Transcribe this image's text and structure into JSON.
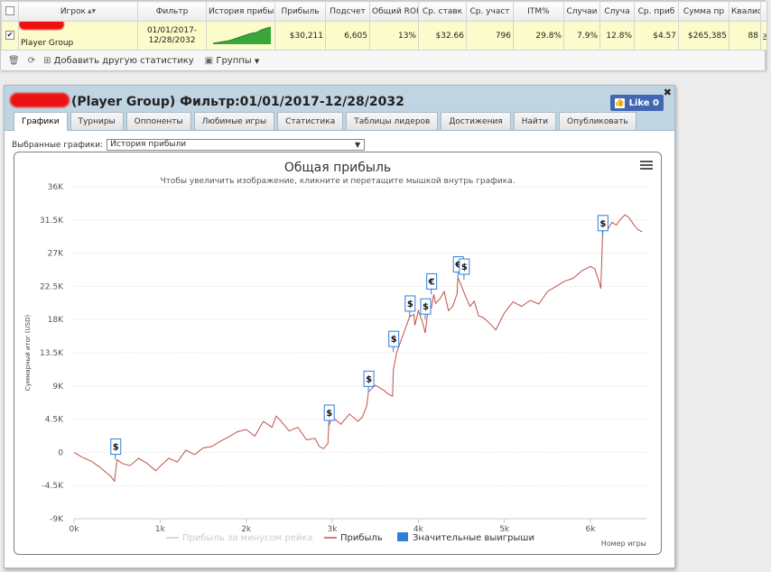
{
  "stats_table": {
    "headers": [
      "Игрок",
      "Фильтр",
      "История прибы",
      "Прибыль",
      "Подсчет",
      "Общий ROI",
      "Ср. ставк",
      "Ср. участ",
      "ITM%",
      "Случаи",
      "Случа",
      "Ср. приб",
      "Сумма пр",
      "Квалис"
    ],
    "row": {
      "player": "Player Group",
      "filter": "01/01/2017-12/28/2032",
      "profit": "$30,211",
      "count": "6,605",
      "roi": "13%",
      "avg_stake": "$32.66",
      "avg_entrants": "796",
      "itm": "29.8%",
      "cases1": "7.9%",
      "cases2": "12.8%",
      "avg_profit": "$4.57",
      "sum_profit": "$265,385",
      "qual": "88",
      "x": "x"
    },
    "toolbar": {
      "add_stat": "Добавить другую статистику",
      "groups": "Группы"
    }
  },
  "window": {
    "title": "(Player Group) Фильтр:01/01/2017-12/28/2032",
    "like_label": "Like 0",
    "tabs": [
      "Графики",
      "Турниры",
      "Оппоненты",
      "Любимые игры",
      "Статистика",
      "Таблицы лидеров",
      "Достижения",
      "Найти",
      "Опубликовать"
    ],
    "active_tab": "Графики",
    "selected_charts_label": "Выбранные графики:",
    "selected_chart": "История прибыли"
  },
  "chart_data": {
    "type": "line",
    "title": "Общая прибыль",
    "subtitle": "Чтобы увеличить изображение, кликните и перетащите мышкой внутрь графика.",
    "ylabel": "Суммарный итог (USD)",
    "xlabel": "Номер игры",
    "ylim": [
      -9000,
      36000
    ],
    "xlim": [
      0,
      6650
    ],
    "yticks": [
      -9000,
      -4500,
      0,
      4500,
      9000,
      13500,
      18000,
      22500,
      27000,
      31500,
      36000
    ],
    "ytick_labels": [
      "-9K",
      "-4.5K",
      "0",
      "4.5K",
      "9K",
      "13.5K",
      "18K",
      "22.5K",
      "27K",
      "31.5K",
      "36K"
    ],
    "xticks": [
      0,
      1000,
      2000,
      3000,
      4000,
      5000,
      6000
    ],
    "xtick_labels": [
      "0k",
      "1k",
      "2k",
      "3k",
      "4k",
      "5k",
      "6k"
    ],
    "legend": [
      {
        "name": "Прибыль за минусом рейка",
        "color": "#cccccc",
        "kind": "line"
      },
      {
        "name": "Прибыль",
        "color": "#c0504d",
        "kind": "line"
      },
      {
        "name": "Значительные выигрыши",
        "color": "#2f7ed8",
        "kind": "box"
      }
    ],
    "series": [
      {
        "name": "Прибыль",
        "color": "#c0504d",
        "x": [
          0,
          100,
          200,
          300,
          380,
          430,
          470,
          500,
          560,
          650,
          750,
          850,
          950,
          1000,
          1100,
          1200,
          1300,
          1400,
          1500,
          1600,
          1700,
          1800,
          1900,
          2000,
          2100,
          2200,
          2300,
          2350,
          2400,
          2500,
          2600,
          2700,
          2800,
          2850,
          2900,
          2950,
          2960,
          3000,
          3100,
          3200,
          3300,
          3350,
          3400,
          3420,
          3500,
          3600,
          3650,
          3700,
          3710,
          3750,
          3800,
          3850,
          3900,
          3950,
          3960,
          4000,
          4050,
          4080,
          4100,
          4120,
          4150,
          4180,
          4200,
          4250,
          4300,
          4350,
          4400,
          4450,
          4460,
          4500,
          4550,
          4600,
          4650,
          4700,
          4750,
          4800,
          4850,
          4900,
          5000,
          5100,
          5200,
          5300,
          5400,
          5500,
          5600,
          5700,
          5800,
          5900,
          6000,
          6050,
          6100,
          6120,
          6140,
          6160,
          6200,
          6250,
          6300,
          6350,
          6400,
          6450,
          6500,
          6550,
          6600
        ],
        "y": [
          0,
          -700,
          -1200,
          -2000,
          -2800,
          -3300,
          -3900,
          -1000,
          -1500,
          -1800,
          -800,
          -1500,
          -2500,
          -1900,
          -800,
          -1300,
          300,
          -300,
          600,
          800,
          1500,
          2100,
          2800,
          3100,
          2200,
          4200,
          3400,
          4900,
          4300,
          2900,
          3400,
          1700,
          1900,
          800,
          500,
          1200,
          3600,
          4800,
          3800,
          5200,
          4200,
          4800,
          6300,
          8200,
          9100,
          8400,
          7900,
          7600,
          11200,
          13600,
          15200,
          16800,
          18400,
          18700,
          17200,
          19200,
          17600,
          16200,
          18000,
          20800,
          19500,
          21400,
          20200,
          20800,
          21800,
          19200,
          19800,
          21500,
          23700,
          22600,
          21100,
          19800,
          20500,
          18500,
          18300,
          17800,
          17200,
          16600,
          18900,
          20400,
          19800,
          20600,
          20100,
          21800,
          22500,
          23200,
          23600,
          24600,
          25200,
          24900,
          23100,
          22200,
          29300,
          31800,
          30200,
          31200,
          30800,
          31600,
          32200,
          31800,
          30900,
          30200,
          29900
        ]
      },
      {
        "name": "Прибыль за минусом рейка",
        "color": "#cccccc",
        "x": [],
        "y": []
      }
    ],
    "flags": [
      {
        "x": 480,
        "y": -1000,
        "label": "$"
      },
      {
        "x": 2960,
        "y": 3600,
        "label": "$"
      },
      {
        "x": 3420,
        "y": 8200,
        "label": "$"
      },
      {
        "x": 3710,
        "y": 13600,
        "label": "$"
      },
      {
        "x": 3900,
        "y": 18400,
        "label": "$"
      },
      {
        "x": 4080,
        "y": 18000,
        "label": "$"
      },
      {
        "x": 4150,
        "y": 21400,
        "label": "€"
      },
      {
        "x": 4460,
        "y": 23700,
        "label": "€"
      },
      {
        "x": 4530,
        "y": 23400,
        "label": "$"
      },
      {
        "x": 6140,
        "y": 29300,
        "label": "$"
      }
    ],
    "grid": true,
    "legend_position": "bottom-center"
  }
}
